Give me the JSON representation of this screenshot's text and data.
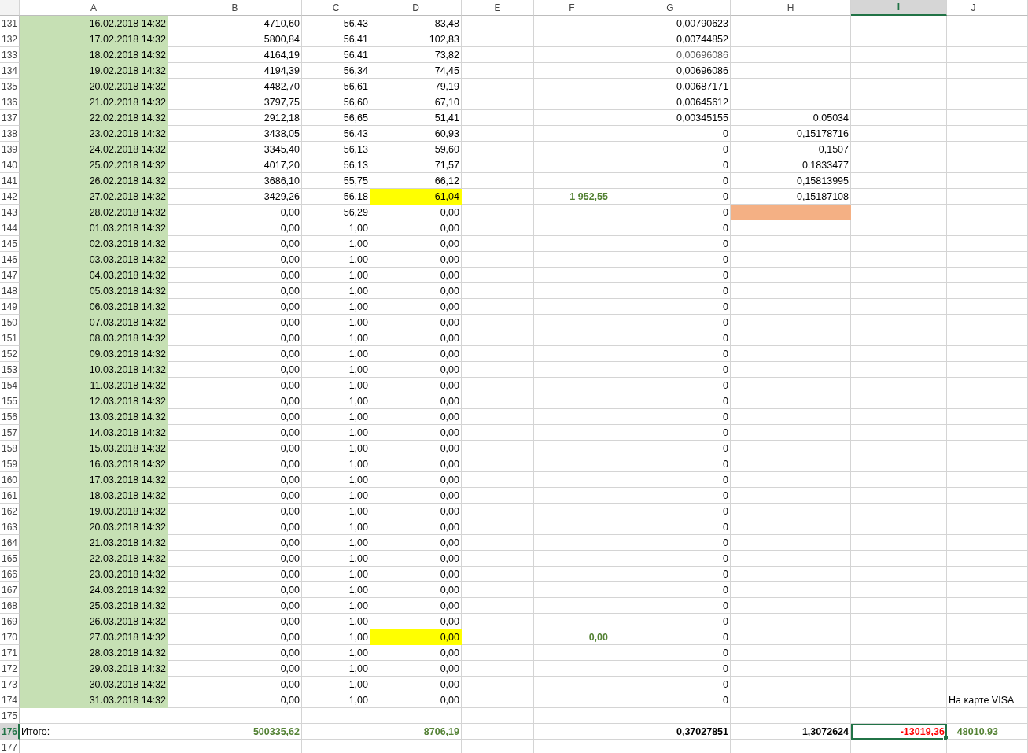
{
  "columns": [
    {
      "label": "A",
      "selected": false
    },
    {
      "label": "B",
      "selected": false
    },
    {
      "label": "C",
      "selected": false
    },
    {
      "label": "D",
      "selected": false
    },
    {
      "label": "E",
      "selected": false
    },
    {
      "label": "F",
      "selected": false
    },
    {
      "label": "G",
      "selected": false
    },
    {
      "label": "H",
      "selected": false
    },
    {
      "label": "I",
      "selected": true
    },
    {
      "label": "J",
      "selected": false
    }
  ],
  "rows": [
    {
      "number": "131",
      "selected": false,
      "cells": [
        {
          "text": "16.02.2018 14:32",
          "color": "#c6e0b4"
        },
        {
          "text": "4710,60"
        },
        {
          "text": "56,43"
        },
        {
          "text": "83,48"
        },
        null,
        null,
        {
          "text": "0,00790623"
        }
      ]
    },
    {
      "number": "132",
      "selected": false,
      "cells": [
        {
          "text": "17.02.2018 14:32",
          "color": "#c6e0b4"
        },
        {
          "text": "5800,84"
        },
        {
          "text": "56,41"
        },
        {
          "text": "102,83"
        },
        null,
        null,
        {
          "text": "0,00744852"
        }
      ]
    },
    {
      "number": "133",
      "selected": false,
      "cells": [
        {
          "text": "18.02.2018 14:32",
          "color": "#c6e0b4"
        },
        {
          "text": "4164,19"
        },
        {
          "text": "56,41"
        },
        {
          "text": "73,82"
        },
        null,
        null,
        {
          "text": "0,00696086",
          "kind": "muted"
        }
      ]
    },
    {
      "number": "134",
      "selected": false,
      "cells": [
        {
          "text": "19.02.2018 14:32",
          "color": "#c6e0b4"
        },
        {
          "text": "4194,39"
        },
        {
          "text": "56,34"
        },
        {
          "text": "74,45"
        },
        null,
        null,
        {
          "text": "0,00696086"
        }
      ]
    },
    {
      "number": "135",
      "selected": false,
      "cells": [
        {
          "text": "20.02.2018 14:32",
          "color": "#c6e0b4"
        },
        {
          "text": "4482,70"
        },
        {
          "text": "56,61"
        },
        {
          "text": "79,19"
        },
        null,
        null,
        {
          "text": "0,00687171"
        }
      ]
    },
    {
      "number": "136",
      "selected": false,
      "cells": [
        {
          "text": "21.02.2018 14:32",
          "color": "#c6e0b4"
        },
        {
          "text": "3797,75"
        },
        {
          "text": "56,60"
        },
        {
          "text": "67,10"
        },
        null,
        null,
        {
          "text": "0,00645612"
        }
      ]
    },
    {
      "number": "137",
      "selected": false,
      "cells": [
        {
          "text": "22.02.2018 14:32",
          "color": "#c6e0b4"
        },
        {
          "text": "2912,18"
        },
        {
          "text": "56,65"
        },
        {
          "text": "51,41"
        },
        null,
        null,
        {
          "text": "0,00345155"
        },
        {
          "text": "0,05034"
        }
      ]
    },
    {
      "number": "138",
      "selected": false,
      "cells": [
        {
          "text": "23.02.2018 14:32",
          "color": "#c6e0b4"
        },
        {
          "text": "3438,05"
        },
        {
          "text": "56,43"
        },
        {
          "text": "60,93"
        },
        null,
        null,
        {
          "text": "0"
        },
        {
          "text": "0,15178716"
        }
      ]
    },
    {
      "number": "139",
      "selected": false,
      "cells": [
        {
          "text": "24.02.2018 14:32",
          "color": "#c6e0b4"
        },
        {
          "text": "3345,40"
        },
        {
          "text": "56,13"
        },
        {
          "text": "59,60"
        },
        null,
        null,
        {
          "text": "0"
        },
        {
          "text": "0,1507"
        }
      ]
    },
    {
      "number": "140",
      "selected": false,
      "cells": [
        {
          "text": "25.02.2018 14:32",
          "color": "#c6e0b4"
        },
        {
          "text": "4017,20"
        },
        {
          "text": "56,13"
        },
        {
          "text": "71,57"
        },
        null,
        null,
        {
          "text": "0"
        },
        {
          "text": "0,1833477"
        }
      ]
    },
    {
      "number": "141",
      "selected": false,
      "cells": [
        {
          "text": "26.02.2018 14:32",
          "color": "#c6e0b4"
        },
        {
          "text": "3686,10"
        },
        {
          "text": "55,75"
        },
        {
          "text": "66,12"
        },
        null,
        null,
        {
          "text": "0"
        },
        {
          "text": "0,15813995"
        }
      ]
    },
    {
      "number": "142",
      "selected": false,
      "cells": [
        {
          "text": "27.02.2018 14:32",
          "color": "#c6e0b4"
        },
        {
          "text": "3429,26"
        },
        {
          "text": "56,18"
        },
        {
          "text": "61,04",
          "color": "#ffff00"
        },
        null,
        {
          "text": "1 952,55",
          "kind": "positive",
          "bold": true
        },
        {
          "text": "0"
        },
        {
          "text": "0,15187108"
        }
      ]
    },
    {
      "number": "143",
      "selected": false,
      "cells": [
        {
          "text": "28.02.2018 14:32",
          "color": "#c6e0b4"
        },
        {
          "text": "0,00"
        },
        {
          "text": "56,29"
        },
        {
          "text": "0,00"
        },
        null,
        null,
        {
          "text": "0"
        },
        {
          "color": "#f4b084"
        }
      ]
    },
    {
      "number": "144",
      "selected": false,
      "cells": [
        {
          "text": "01.03.2018 14:32",
          "color": "#c6e0b4"
        },
        {
          "text": "0,00"
        },
        {
          "text": "1,00"
        },
        {
          "text": "0,00"
        },
        null,
        null,
        {
          "text": "0"
        }
      ]
    },
    {
      "number": "145",
      "selected": false,
      "cells": [
        {
          "text": "02.03.2018 14:32",
          "color": "#c6e0b4"
        },
        {
          "text": "0,00"
        },
        {
          "text": "1,00"
        },
        {
          "text": "0,00"
        },
        null,
        null,
        {
          "text": "0"
        }
      ]
    },
    {
      "number": "146",
      "selected": false,
      "cells": [
        {
          "text": "03.03.2018 14:32",
          "color": "#c6e0b4"
        },
        {
          "text": "0,00"
        },
        {
          "text": "1,00"
        },
        {
          "text": "0,00"
        },
        null,
        null,
        {
          "text": "0"
        }
      ]
    },
    {
      "number": "147",
      "selected": false,
      "cells": [
        {
          "text": "04.03.2018 14:32",
          "color": "#c6e0b4"
        },
        {
          "text": "0,00"
        },
        {
          "text": "1,00"
        },
        {
          "text": "0,00"
        },
        null,
        null,
        {
          "text": "0"
        }
      ]
    },
    {
      "number": "148",
      "selected": false,
      "cells": [
        {
          "text": "05.03.2018 14:32",
          "color": "#c6e0b4"
        },
        {
          "text": "0,00"
        },
        {
          "text": "1,00"
        },
        {
          "text": "0,00"
        },
        null,
        null,
        {
          "text": "0"
        }
      ]
    },
    {
      "number": "149",
      "selected": false,
      "cells": [
        {
          "text": "06.03.2018 14:32",
          "color": "#c6e0b4"
        },
        {
          "text": "0,00"
        },
        {
          "text": "1,00"
        },
        {
          "text": "0,00"
        },
        null,
        null,
        {
          "text": "0"
        }
      ]
    },
    {
      "number": "150",
      "selected": false,
      "cells": [
        {
          "text": "07.03.2018 14:32",
          "color": "#c6e0b4"
        },
        {
          "text": "0,00"
        },
        {
          "text": "1,00"
        },
        {
          "text": "0,00"
        },
        null,
        null,
        {
          "text": "0"
        }
      ]
    },
    {
      "number": "151",
      "selected": false,
      "cells": [
        {
          "text": "08.03.2018 14:32",
          "color": "#c6e0b4"
        },
        {
          "text": "0,00"
        },
        {
          "text": "1,00"
        },
        {
          "text": "0,00"
        },
        null,
        null,
        {
          "text": "0"
        }
      ]
    },
    {
      "number": "152",
      "selected": false,
      "cells": [
        {
          "text": "09.03.2018 14:32",
          "color": "#c6e0b4"
        },
        {
          "text": "0,00"
        },
        {
          "text": "1,00"
        },
        {
          "text": "0,00"
        },
        null,
        null,
        {
          "text": "0"
        }
      ]
    },
    {
      "number": "153",
      "selected": false,
      "cells": [
        {
          "text": "10.03.2018 14:32",
          "color": "#c6e0b4"
        },
        {
          "text": "0,00"
        },
        {
          "text": "1,00"
        },
        {
          "text": "0,00"
        },
        null,
        null,
        {
          "text": "0"
        }
      ]
    },
    {
      "number": "154",
      "selected": false,
      "cells": [
        {
          "text": "11.03.2018 14:32",
          "color": "#c6e0b4"
        },
        {
          "text": "0,00"
        },
        {
          "text": "1,00"
        },
        {
          "text": "0,00"
        },
        null,
        null,
        {
          "text": "0"
        }
      ]
    },
    {
      "number": "155",
      "selected": false,
      "cells": [
        {
          "text": "12.03.2018 14:32",
          "color": "#c6e0b4"
        },
        {
          "text": "0,00"
        },
        {
          "text": "1,00"
        },
        {
          "text": "0,00"
        },
        null,
        null,
        {
          "text": "0"
        }
      ]
    },
    {
      "number": "156",
      "selected": false,
      "cells": [
        {
          "text": "13.03.2018 14:32",
          "color": "#c6e0b4"
        },
        {
          "text": "0,00"
        },
        {
          "text": "1,00"
        },
        {
          "text": "0,00"
        },
        null,
        null,
        {
          "text": "0"
        }
      ]
    },
    {
      "number": "157",
      "selected": false,
      "cells": [
        {
          "text": "14.03.2018 14:32",
          "color": "#c6e0b4"
        },
        {
          "text": "0,00"
        },
        {
          "text": "1,00"
        },
        {
          "text": "0,00"
        },
        null,
        null,
        {
          "text": "0"
        }
      ]
    },
    {
      "number": "158",
      "selected": false,
      "cells": [
        {
          "text": "15.03.2018 14:32",
          "color": "#c6e0b4"
        },
        {
          "text": "0,00"
        },
        {
          "text": "1,00"
        },
        {
          "text": "0,00"
        },
        null,
        null,
        {
          "text": "0"
        }
      ]
    },
    {
      "number": "159",
      "selected": false,
      "cells": [
        {
          "text": "16.03.2018 14:32",
          "color": "#c6e0b4"
        },
        {
          "text": "0,00"
        },
        {
          "text": "1,00"
        },
        {
          "text": "0,00"
        },
        null,
        null,
        {
          "text": "0"
        }
      ]
    },
    {
      "number": "160",
      "selected": false,
      "cells": [
        {
          "text": "17.03.2018 14:32",
          "color": "#c6e0b4"
        },
        {
          "text": "0,00"
        },
        {
          "text": "1,00"
        },
        {
          "text": "0,00"
        },
        null,
        null,
        {
          "text": "0"
        }
      ]
    },
    {
      "number": "161",
      "selected": false,
      "cells": [
        {
          "text": "18.03.2018 14:32",
          "color": "#c6e0b4"
        },
        {
          "text": "0,00"
        },
        {
          "text": "1,00"
        },
        {
          "text": "0,00"
        },
        null,
        null,
        {
          "text": "0"
        }
      ]
    },
    {
      "number": "162",
      "selected": false,
      "cells": [
        {
          "text": "19.03.2018 14:32",
          "color": "#c6e0b4"
        },
        {
          "text": "0,00"
        },
        {
          "text": "1,00"
        },
        {
          "text": "0,00"
        },
        null,
        null,
        {
          "text": "0"
        }
      ]
    },
    {
      "number": "163",
      "selected": false,
      "cells": [
        {
          "text": "20.03.2018 14:32",
          "color": "#c6e0b4"
        },
        {
          "text": "0,00"
        },
        {
          "text": "1,00"
        },
        {
          "text": "0,00"
        },
        null,
        null,
        {
          "text": "0"
        }
      ]
    },
    {
      "number": "164",
      "selected": false,
      "cells": [
        {
          "text": "21.03.2018 14:32",
          "color": "#c6e0b4"
        },
        {
          "text": "0,00"
        },
        {
          "text": "1,00"
        },
        {
          "text": "0,00"
        },
        null,
        null,
        {
          "text": "0"
        }
      ]
    },
    {
      "number": "165",
      "selected": false,
      "cells": [
        {
          "text": "22.03.2018 14:32",
          "color": "#c6e0b4"
        },
        {
          "text": "0,00"
        },
        {
          "text": "1,00"
        },
        {
          "text": "0,00"
        },
        null,
        null,
        {
          "text": "0"
        }
      ]
    },
    {
      "number": "166",
      "selected": false,
      "cells": [
        {
          "text": "23.03.2018 14:32",
          "color": "#c6e0b4"
        },
        {
          "text": "0,00"
        },
        {
          "text": "1,00"
        },
        {
          "text": "0,00"
        },
        null,
        null,
        {
          "text": "0"
        }
      ]
    },
    {
      "number": "167",
      "selected": false,
      "cells": [
        {
          "text": "24.03.2018 14:32",
          "color": "#c6e0b4"
        },
        {
          "text": "0,00"
        },
        {
          "text": "1,00"
        },
        {
          "text": "0,00"
        },
        null,
        null,
        {
          "text": "0"
        }
      ]
    },
    {
      "number": "168",
      "selected": false,
      "cells": [
        {
          "text": "25.03.2018 14:32",
          "color": "#c6e0b4"
        },
        {
          "text": "0,00"
        },
        {
          "text": "1,00"
        },
        {
          "text": "0,00"
        },
        null,
        null,
        {
          "text": "0"
        }
      ]
    },
    {
      "number": "169",
      "selected": false,
      "cells": [
        {
          "text": "26.03.2018 14:32",
          "color": "#c6e0b4"
        },
        {
          "text": "0,00"
        },
        {
          "text": "1,00"
        },
        {
          "text": "0,00"
        },
        null,
        null,
        {
          "text": "0"
        }
      ]
    },
    {
      "number": "170",
      "selected": false,
      "cells": [
        {
          "text": "27.03.2018 14:32",
          "color": "#c6e0b4"
        },
        {
          "text": "0,00"
        },
        {
          "text": "1,00"
        },
        {
          "text": "0,00",
          "color": "#ffff00"
        },
        null,
        {
          "text": "0,00",
          "kind": "positive",
          "bold": true
        },
        {
          "text": "0"
        }
      ]
    },
    {
      "number": "171",
      "selected": false,
      "cells": [
        {
          "text": "28.03.2018 14:32",
          "color": "#c6e0b4"
        },
        {
          "text": "0,00"
        },
        {
          "text": "1,00"
        },
        {
          "text": "0,00"
        },
        null,
        null,
        {
          "text": "0"
        }
      ]
    },
    {
      "number": "172",
      "selected": false,
      "cells": [
        {
          "text": "29.03.2018 14:32",
          "color": "#c6e0b4"
        },
        {
          "text": "0,00"
        },
        {
          "text": "1,00"
        },
        {
          "text": "0,00"
        },
        null,
        null,
        {
          "text": "0"
        }
      ]
    },
    {
      "number": "173",
      "selected": false,
      "cells": [
        {
          "text": "30.03.2018 14:32",
          "color": "#c6e0b4"
        },
        {
          "text": "0,00"
        },
        {
          "text": "1,00"
        },
        {
          "text": "0,00"
        },
        null,
        null,
        {
          "text": "0"
        }
      ]
    },
    {
      "number": "174",
      "selected": false,
      "cells": [
        {
          "text": "31.03.2018 14:32",
          "color": "#c6e0b4"
        },
        {
          "text": "0,00"
        },
        {
          "text": "1,00"
        },
        {
          "text": "0,00"
        },
        null,
        null,
        {
          "text": "0"
        },
        null,
        null,
        {
          "text": "На карте VISA",
          "kind": "label"
        }
      ]
    },
    {
      "number": "175",
      "selected": false,
      "cells": []
    },
    {
      "number": "176",
      "selected": true,
      "cells": [
        {
          "text": "Итого:",
          "kind": "label"
        },
        {
          "text": "500335,62",
          "kind": "positive",
          "bold": true
        },
        null,
        {
          "text": "8706,19",
          "kind": "positive",
          "bold": true
        },
        null,
        null,
        {
          "text": "0,37027851",
          "bold": true
        },
        {
          "text": "1,3072624",
          "bold": true
        },
        {
          "text": "-13019,36",
          "kind": "negative",
          "bold": true,
          "active": true
        },
        {
          "text": "48010,93",
          "kind": "positive",
          "bold": true
        }
      ]
    },
    {
      "number": "177",
      "selected": false,
      "cells": []
    }
  ]
}
